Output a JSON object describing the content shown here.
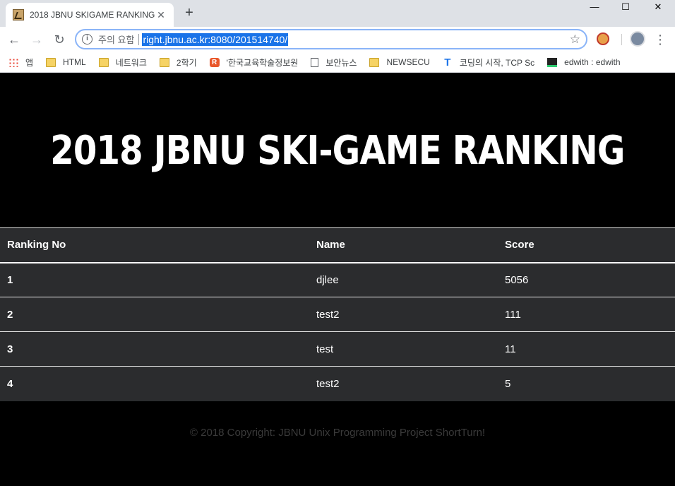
{
  "browser": {
    "tab_title": "2018 JBNU SKIGAME RANKING",
    "tab_close": "✕",
    "new_tab": "+",
    "window_controls": {
      "minimize": "—",
      "maximize": "☐",
      "close": "✕"
    },
    "nav": {
      "back": "←",
      "forward": "→",
      "reload": "↻"
    },
    "omnibox": {
      "security_label": "주의 요함",
      "url": "right.jbnu.ac.kr:8080/201514740/"
    },
    "bookmarks": [
      {
        "label": "앱",
        "icon": "apps-grid-icon"
      },
      {
        "label": "HTML",
        "icon": "folder-icon"
      },
      {
        "label": "네트워크",
        "icon": "folder-icon"
      },
      {
        "label": "2학기",
        "icon": "folder-icon"
      },
      {
        "label": "'한국교육학술정보원",
        "icon": "riss-icon"
      },
      {
        "label": "보안뉴스",
        "icon": "page-icon"
      },
      {
        "label": "NEWSECU",
        "icon": "folder-icon"
      },
      {
        "label": "코딩의 시작, TCP Sc",
        "icon": "tcp-school-icon"
      },
      {
        "label": "edwith : edwith",
        "icon": "edwith-icon"
      }
    ]
  },
  "page": {
    "title": "2018 JBNU SKI-GAME RANKING",
    "table": {
      "headers": [
        "Ranking No",
        "Name",
        "Score"
      ],
      "rows": [
        [
          "1",
          "djlee",
          "5056"
        ],
        [
          "2",
          "test2",
          "111"
        ],
        [
          "3",
          "test",
          "11"
        ],
        [
          "4",
          "test2",
          "5"
        ]
      ]
    },
    "footer": "© 2018 Copyright: JBNU Unix Programming Project ShortTurn!"
  }
}
